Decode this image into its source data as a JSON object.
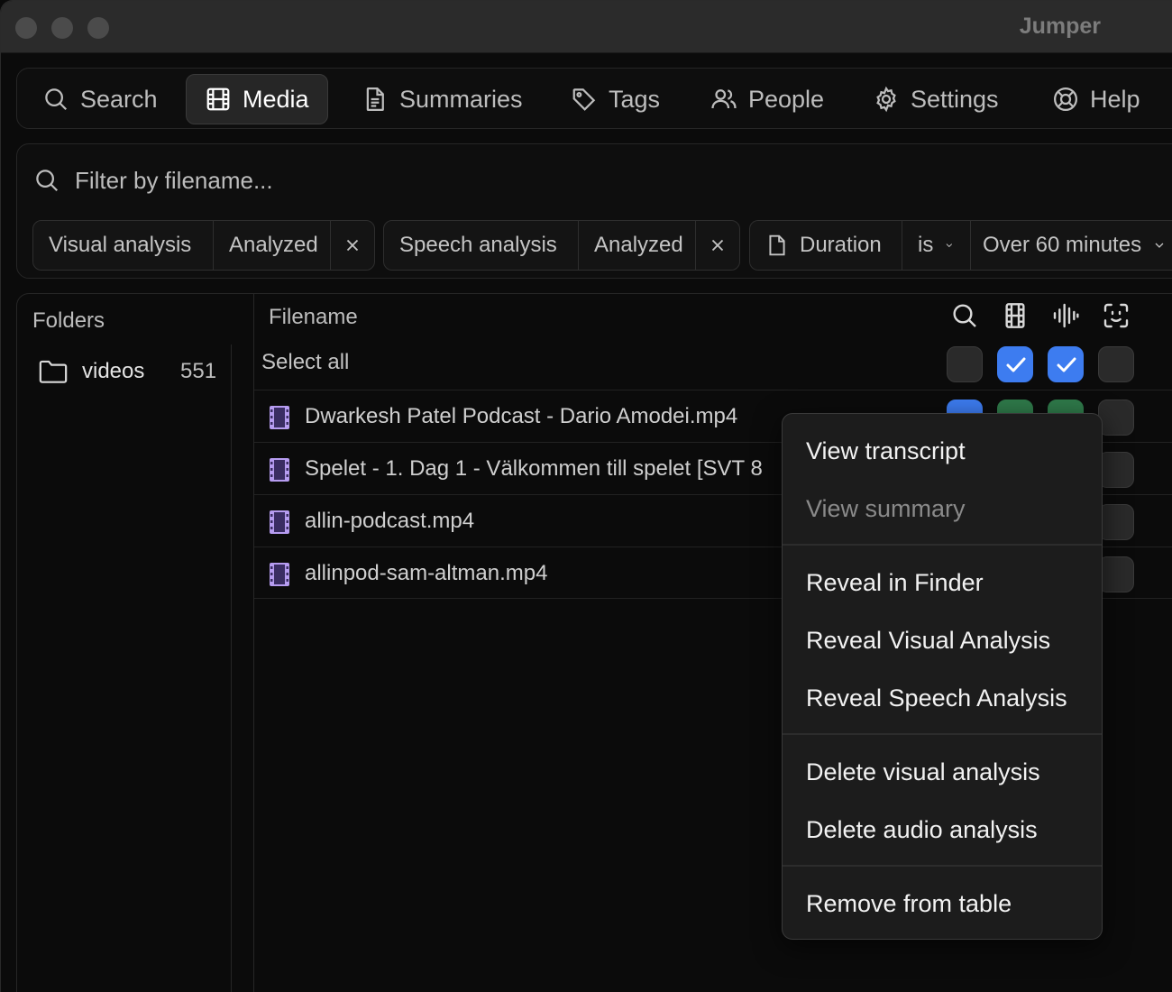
{
  "window": {
    "title": "Jumper"
  },
  "nav": {
    "items": [
      {
        "label": "Search",
        "icon": "search-icon"
      },
      {
        "label": "Media",
        "icon": "film-icon",
        "active": true
      },
      {
        "label": "Summaries",
        "icon": "document-icon"
      },
      {
        "label": "Tags",
        "icon": "tag-icon"
      },
      {
        "label": "People",
        "icon": "people-icon"
      },
      {
        "label": "Settings",
        "icon": "gear-icon"
      },
      {
        "label": "Help",
        "icon": "lifebuoy-icon"
      }
    ]
  },
  "filter": {
    "placeholder": "Filter by filename...",
    "chips": [
      {
        "field": "Visual analysis",
        "value": "Analyzed"
      },
      {
        "field": "Speech analysis",
        "value": "Analyzed"
      },
      {
        "field": "Duration",
        "operator": "is",
        "value": "Over 60 minutes"
      }
    ]
  },
  "folders": {
    "title": "Folders",
    "items": [
      {
        "name": "videos",
        "count": "551"
      }
    ]
  },
  "table": {
    "header": "Filename",
    "select_all": "Select all",
    "rows": [
      {
        "name": "Dwarkesh Patel Podcast - Dario Amodei.mp4"
      },
      {
        "name": "Spelet - 1. Dag 1 - Välkommen till spelet [SVT 8"
      },
      {
        "name": "allin-podcast.mp4"
      },
      {
        "name": "allinpod-sam-altman.mp4"
      }
    ]
  },
  "context_menu": {
    "items": [
      {
        "label": "View transcript"
      },
      {
        "label": "View summary",
        "disabled": true
      },
      {
        "label": "Reveal in Finder"
      },
      {
        "label": "Reveal Visual Analysis"
      },
      {
        "label": "Reveal Speech Analysis"
      },
      {
        "label": "Delete visual analysis"
      },
      {
        "label": "Delete audio analysis"
      },
      {
        "label": "Remove from table"
      }
    ]
  },
  "colors": {
    "accent_blue": "#3d7cf0",
    "accent_green": "#2f7a4a",
    "file_icon": "#b69cf0"
  }
}
